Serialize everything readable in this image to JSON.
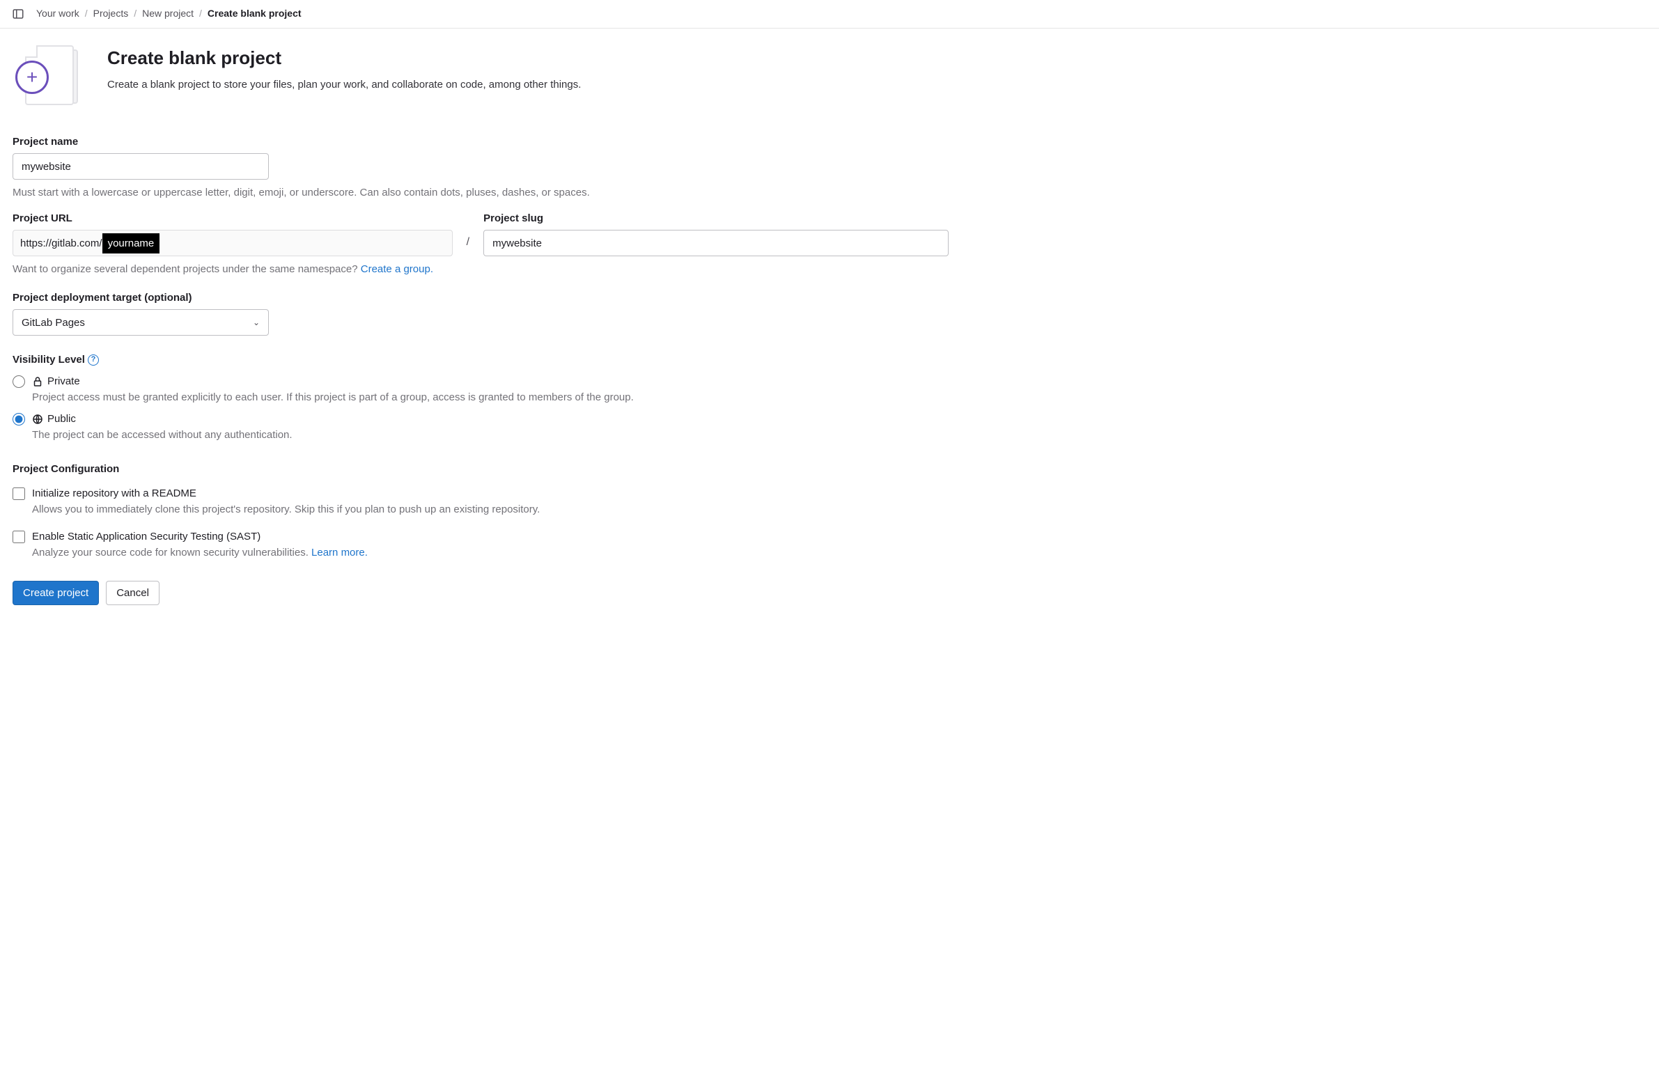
{
  "breadcrumb": {
    "items": [
      "Your work",
      "Projects",
      "New project"
    ],
    "current": "Create blank project"
  },
  "header": {
    "title": "Create blank project",
    "subtitle": "Create a blank project to store your files, plan your work, and collaborate on code, among other things."
  },
  "form": {
    "name": {
      "label": "Project name",
      "value": "mywebsite",
      "help": "Must start with a lowercase or uppercase letter, digit, emoji, or underscore. Can also contain dots, pluses, dashes, or spaces."
    },
    "url": {
      "label": "Project URL",
      "prefix": "https://gitlab.com/",
      "namespace": "yourname",
      "group_prompt": "Want to organize several dependent projects under the same namespace? ",
      "group_link": "Create a group."
    },
    "slug": {
      "label": "Project slug",
      "value": "mywebsite"
    },
    "deployment": {
      "label": "Project deployment target (optional)",
      "selected": "GitLab Pages"
    },
    "visibility": {
      "label": "Visibility Level",
      "options": [
        {
          "key": "private",
          "title": "Private",
          "desc": "Project access must be granted explicitly to each user. If this project is part of a group, access is granted to members of the group.",
          "checked": false
        },
        {
          "key": "public",
          "title": "Public",
          "desc": "The project can be accessed without any authentication.",
          "checked": true
        }
      ]
    },
    "configuration": {
      "label": "Project Configuration",
      "options": [
        {
          "key": "readme",
          "title": "Initialize repository with a README",
          "desc": "Allows you to immediately clone this project's repository. Skip this if you plan to push up an existing repository."
        },
        {
          "key": "sast",
          "title": "Enable Static Application Security Testing (SAST)",
          "desc": "Analyze your source code for known security vulnerabilities. ",
          "link": "Learn more."
        }
      ]
    },
    "actions": {
      "submit": "Create project",
      "cancel": "Cancel"
    }
  }
}
